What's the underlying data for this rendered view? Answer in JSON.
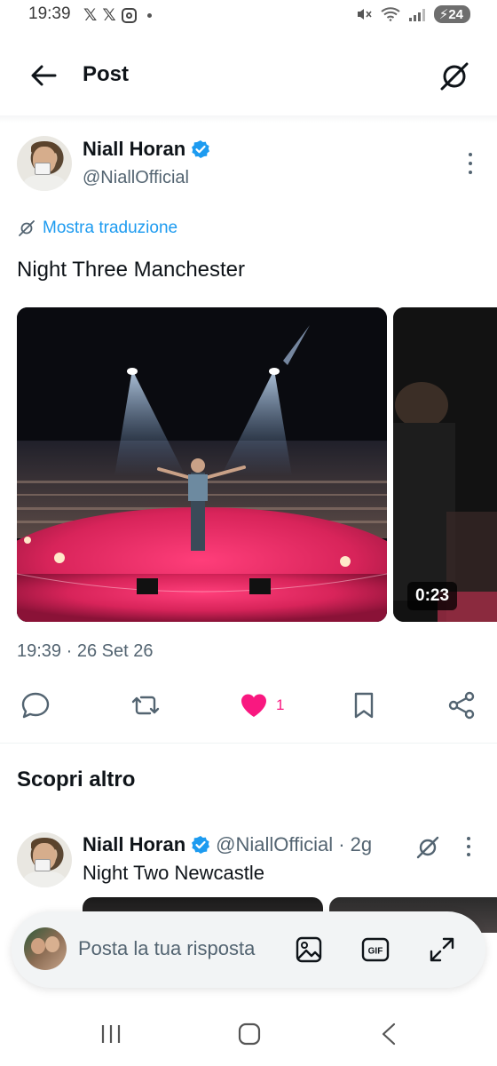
{
  "status_bar": {
    "time": "19:39",
    "battery": "24",
    "left_icons": [
      "x-icon",
      "x-icon",
      "instagram-icon",
      "dot"
    ],
    "right_icons": [
      "mute-icon",
      "wifi-icon",
      "signal-icon",
      "battery-icon"
    ]
  },
  "header": {
    "title": "Post"
  },
  "post": {
    "author_name": "Niall Horan",
    "author_handle": "@NiallOfficial",
    "translate_label": "Mostra traduzione",
    "text": "Night Three Manchester",
    "video_duration": "0:23",
    "meta": "19:39 · 26 Set 26",
    "like_count": "1",
    "like_color": "#f91880",
    "verified_color": "#1d9bf0"
  },
  "discover": {
    "title": "Scopri altro",
    "item": {
      "author_name": "Niall Horan",
      "author_handle": "@NiallOfficial · 2g",
      "text": "Night Two Newcastle"
    }
  },
  "reply": {
    "placeholder": "Posta la tua risposta"
  },
  "colors": {
    "accent": "#1d9bf0",
    "text": "#0f1419",
    "secondary": "#536471"
  }
}
